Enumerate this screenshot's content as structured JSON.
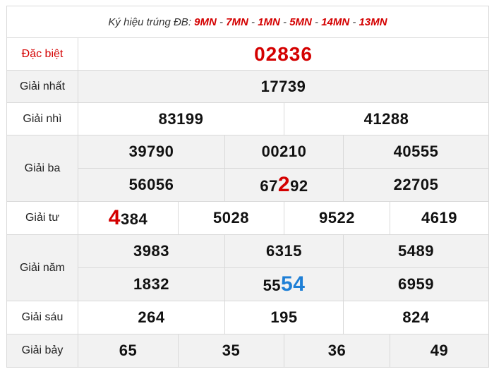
{
  "header": {
    "prefix": "Ký hiệu trúng ĐB: ",
    "codes": [
      "9MN",
      "7MN",
      "1MN",
      "5MN",
      "14MN",
      "13MN"
    ],
    "separator": " - "
  },
  "special": {
    "label": "Đặc biệt",
    "number": "02836"
  },
  "first": {
    "label": "Giải nhất",
    "number": "17739"
  },
  "second": {
    "label": "Giải nhì",
    "numbers": [
      "83199",
      "41288"
    ]
  },
  "third": {
    "label": "Giải ba",
    "numbers": [
      "39790",
      "00210",
      "40555",
      "56056",
      "22705"
    ],
    "n5": {
      "pre": "67",
      "hl": "2",
      "post": "92"
    }
  },
  "fourth": {
    "label": "Giải tư",
    "n1": {
      "hl": "4",
      "post": "384"
    },
    "numbers": [
      "5028",
      "9522",
      "4619"
    ]
  },
  "fifth": {
    "label": "Giải năm",
    "numbers": [
      "3983",
      "6315",
      "5489",
      "1832",
      "6959"
    ],
    "n5": {
      "pre": "55",
      "hl": "54"
    }
  },
  "sixth": {
    "label": "Giải sáu",
    "numbers": [
      "264",
      "195",
      "824"
    ]
  },
  "seventh": {
    "label": "Giải bảy",
    "numbers": [
      "65",
      "35",
      "36",
      "49"
    ]
  },
  "colors": {
    "red": "#d40000",
    "blue": "#1e7fd6",
    "row_gray": "#f2f2f2"
  }
}
